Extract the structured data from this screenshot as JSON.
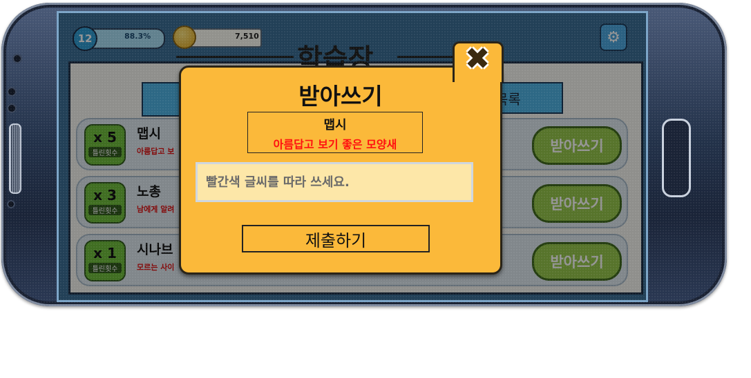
{
  "hud": {
    "level": "12",
    "progress": "88.3%",
    "coins": "7,510"
  },
  "page": {
    "title": "학습장",
    "tab_right": "목록"
  },
  "rows": [
    {
      "count": "x 5",
      "count_label": "틀린횟수",
      "word": "맵시",
      "meaning": "아름답고 보",
      "button": "받아쓰기"
    },
    {
      "count": "x 3",
      "count_label": "틀린횟수",
      "word": "노총",
      "meaning": "남에게 알려",
      "button": "받아쓰기"
    },
    {
      "count": "x 1",
      "count_label": "틀린횟수",
      "word": "시나브",
      "meaning": "모르는 사이",
      "button": "받아쓰기"
    }
  ],
  "modal": {
    "title": "받아쓰기",
    "word": "맵시",
    "meaning": "아름답고 보기 좋은 모양새",
    "input_placeholder": "빨간색 글씨를 따라 쓰세요.",
    "submit_label": "제출하기"
  },
  "icons": [
    "gear-icon",
    "coin-icon",
    "close-icon"
  ]
}
